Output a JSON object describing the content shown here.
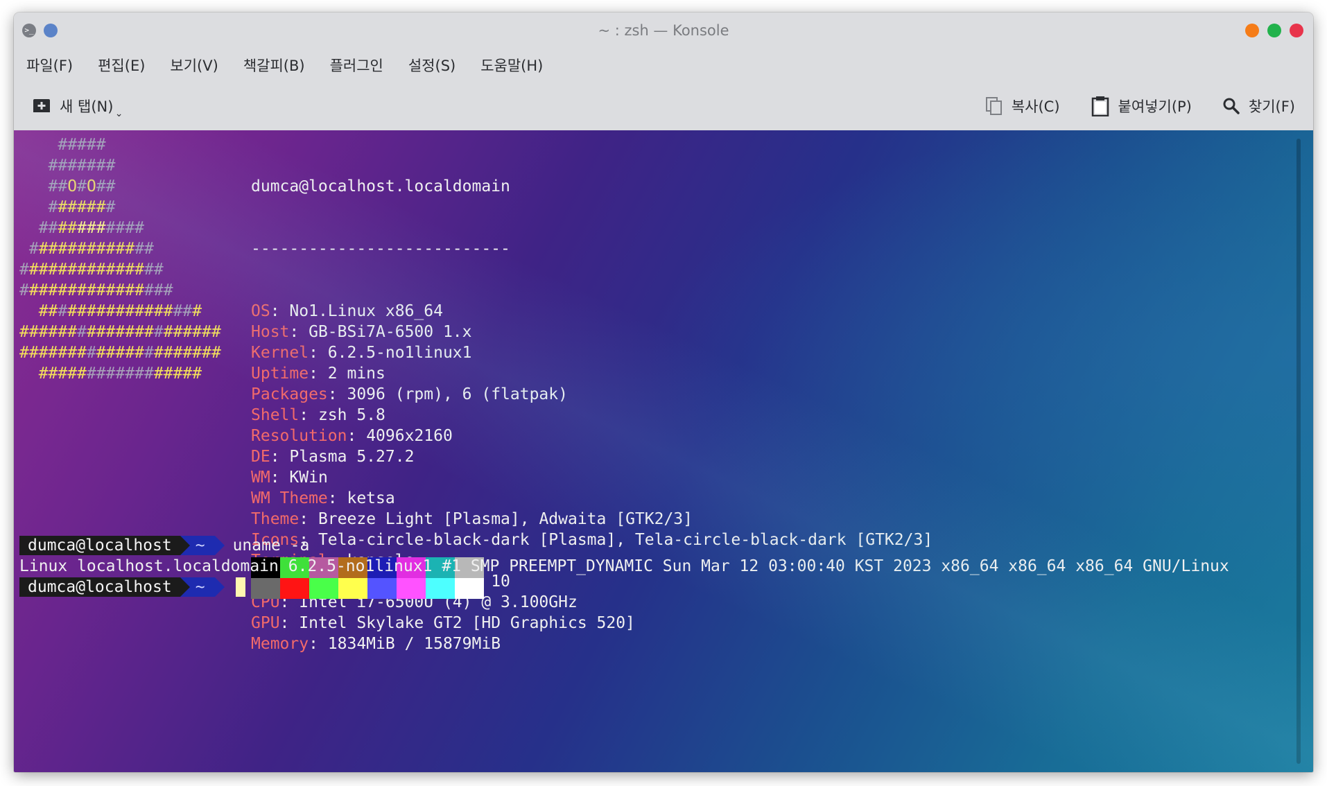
{
  "window": {
    "title": "~ : zsh — Konsole",
    "controls": [
      {
        "name": "minimize",
        "color": "#f57c18"
      },
      {
        "name": "maximize",
        "color": "#22b24c"
      },
      {
        "name": "close",
        "color": "#e8344b"
      }
    ]
  },
  "menu": [
    "파일(F)",
    "편집(E)",
    "보기(V)",
    "책갈피(B)",
    "플러그인",
    "설정(S)",
    "도움말(H)"
  ],
  "toolbar": {
    "new_tab": "새 탭(N)",
    "new_tab_icon": "new-tab-icon",
    "chevron": "⌄",
    "copy": "복사(C)",
    "paste": "붙여넣기(P)",
    "find": "찾기(F)"
  },
  "logo_lines": [
    [
      {
        "t": "    #####",
        "c": "#a7a0b8"
      }
    ],
    [
      {
        "t": "   #######",
        "c": "#a7a0b8"
      }
    ],
    [
      {
        "t": "   ##",
        "c": "#a7a0b8"
      },
      {
        "t": "O",
        "c": "#f0d66a"
      },
      {
        "t": "#",
        "c": "#a7a0b8"
      },
      {
        "t": "O",
        "c": "#f0d66a"
      },
      {
        "t": "##",
        "c": "#a7a0b8"
      }
    ],
    [
      {
        "t": "   #",
        "c": "#a7a0b8"
      },
      {
        "t": "#####",
        "c": "#f4e05a"
      },
      {
        "t": "#",
        "c": "#a7a0b8"
      }
    ],
    [
      {
        "t": "  ##",
        "c": "#a7a0b8"
      },
      {
        "t": "##",
        "c": "#f4e05a"
      },
      {
        "t": "###",
        "c": "#fff58a"
      },
      {
        "t": "####",
        "c": "#a7a0b8"
      }
    ],
    [
      {
        "t": " #",
        "c": "#a7a0b8"
      },
      {
        "t": "##########",
        "c": "#f4e05a"
      },
      {
        "t": "##",
        "c": "#a7a0b8"
      }
    ],
    [
      {
        "t": "#",
        "c": "#a7a0b8"
      },
      {
        "t": "############",
        "c": "#f4e05a"
      },
      {
        "t": "##",
        "c": "#a7a0b8"
      }
    ],
    [
      {
        "t": "#",
        "c": "#a7a0b8"
      },
      {
        "t": "############",
        "c": "#f4e05a"
      },
      {
        "t": "###",
        "c": "#a7a0b8"
      }
    ],
    [
      {
        "t": "  ##",
        "c": "#f4e05a"
      },
      {
        "t": "#",
        "c": "#a7a0b8"
      },
      {
        "t": "###########",
        "c": "#f4e05a"
      },
      {
        "t": "##",
        "c": "#a7a0b8"
      },
      {
        "t": "#",
        "c": "#f4e05a"
      }
    ],
    [
      {
        "t": "######",
        "c": "#f4e05a"
      },
      {
        "t": "#",
        "c": "#a7a0b8"
      },
      {
        "t": "#######",
        "c": "#f4e05a"
      },
      {
        "t": "#",
        "c": "#a7a0b8"
      },
      {
        "t": "######",
        "c": "#f4e05a"
      }
    ],
    [
      {
        "t": "#######",
        "c": "#f4e05a"
      },
      {
        "t": "#",
        "c": "#a7a0b8"
      },
      {
        "t": "#####",
        "c": "#f4e05a"
      },
      {
        "t": "#",
        "c": "#a7a0b8"
      },
      {
        "t": "#######",
        "c": "#f4e05a"
      }
    ],
    [
      {
        "t": "  #####",
        "c": "#f4e05a"
      },
      {
        "t": "#######",
        "c": "#a7a0b8"
      },
      {
        "t": "#####",
        "c": "#f4e05a"
      }
    ]
  ],
  "info": {
    "user_host": "dumca@localhost.localdomain",
    "separator": "---------------------------",
    "fields": [
      {
        "key": "OS",
        "value": "No1.Linux x86_64"
      },
      {
        "key": "Host",
        "value": "GB-BSi7A-6500 1.x"
      },
      {
        "key": "Kernel",
        "value": "6.2.5-no1linux1"
      },
      {
        "key": "Uptime",
        "value": "2 mins"
      },
      {
        "key": "Packages",
        "value": "3096 (rpm), 6 (flatpak)"
      },
      {
        "key": "Shell",
        "value": "zsh 5.8"
      },
      {
        "key": "Resolution",
        "value": "4096x2160"
      },
      {
        "key": "DE",
        "value": "Plasma 5.27.2"
      },
      {
        "key": "WM",
        "value": "KWin"
      },
      {
        "key": "WM Theme",
        "value": "ketsa"
      },
      {
        "key": "Theme",
        "value": "Breeze Light [Plasma], Adwaita [GTK2/3]"
      },
      {
        "key": "Icons",
        "value": "Tela-circle-black-dark [Plasma], Tela-circle-black-dark [GTK2/3]"
      },
      {
        "key": "Terminal",
        "value": "konsole"
      },
      {
        "key": "Terminal Font",
        "value": "Noto Mono 10"
      },
      {
        "key": "CPU",
        "value": "Intel i7-6500U (4) @ 3.100GHz"
      },
      {
        "key": "GPU",
        "value": "Intel Skylake GT2 [HD Graphics 520]"
      },
      {
        "key": "Memory",
        "value": "1834MiB / 15879MiB"
      }
    ]
  },
  "palette": {
    "normal": [
      "#000000",
      "#3fe03a",
      "#b65aa0",
      "#b26c1c",
      "#1d1db5",
      "#e12ee1",
      "#1bb3b3",
      "#b8b8b8"
    ],
    "bright": [
      "#6a6a6a",
      "#ff1414",
      "#49ff49",
      "#ffff4d",
      "#5454ff",
      "#ff52ff",
      "#4dffff",
      "#ffffff"
    ]
  },
  "session": {
    "prompt_user": "dumca@localhost",
    "prompt_dir": "~",
    "command": "uname -a",
    "output": "Linux localhost.localdomain 6.2.5-no1linux1 #1 SMP PREEMPT_DYNAMIC Sun Mar 12 03:00:40 KST 2023 x86_64 x86_64 x86_64 GNU/Linux"
  }
}
